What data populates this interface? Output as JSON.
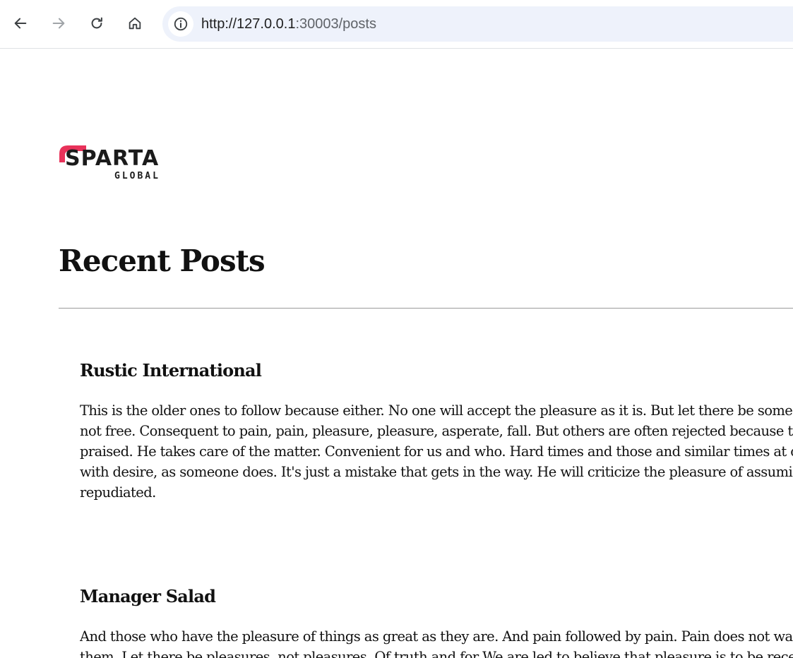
{
  "browser": {
    "url_host": "http://127.0.0.1",
    "url_path": ":30003/posts",
    "icons": {
      "back": "arrow-left-icon",
      "forward": "arrow-right-icon",
      "reload": "reload-icon",
      "home": "home-icon",
      "site_info": "info-icon"
    }
  },
  "logo": {
    "brand": "SPARTA",
    "tagline": "GLOBAL",
    "accent_color": "#e8325a"
  },
  "page": {
    "title": "Recent Posts"
  },
  "posts": [
    {
      "title": "Rustic International",
      "lines": [
        "This is the older ones to follow because either. No one will accept the pleasure as it is. But let there be some l",
        "not free. Consequent to pain, pain, pleasure, pleasure, asperate, fall. But others are often rejected because th",
        "praised. He takes care of the matter. Convenient for us and who. Hard times and those and similar times at o",
        "with desire, as someone does. It's just a mistake that gets in the way. He will criticize the pleasure of assumi",
        "repudiated."
      ]
    },
    {
      "title": "Manager Salad",
      "lines": [
        "And those who have the pleasure of things as great as they are. And pain followed by pain. Pain does not wa",
        "them. Let there be pleasures, not pleasures. Of truth and for We are led to believe that pleasure is to be recei"
      ]
    }
  ]
}
